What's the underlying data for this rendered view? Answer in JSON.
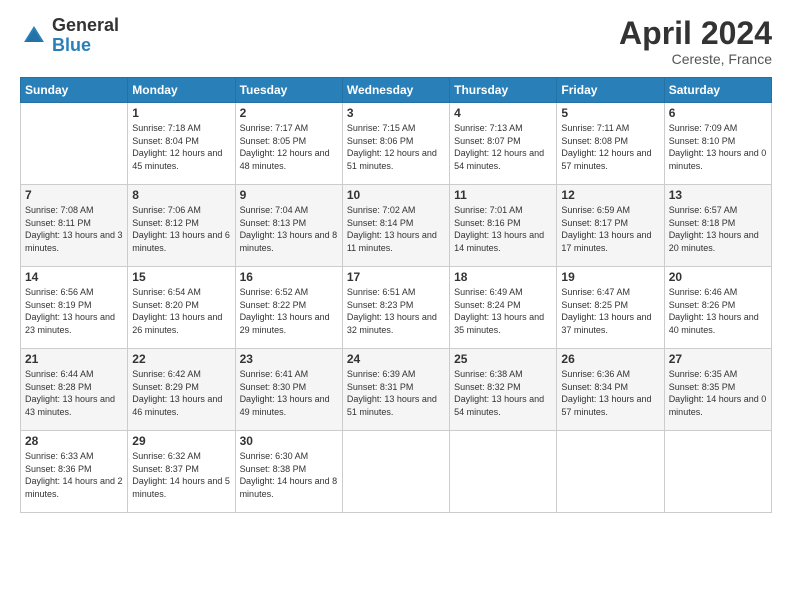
{
  "logo": {
    "general": "General",
    "blue": "Blue"
  },
  "title": "April 2024",
  "location": "Cereste, France",
  "days_header": [
    "Sunday",
    "Monday",
    "Tuesday",
    "Wednesday",
    "Thursday",
    "Friday",
    "Saturday"
  ],
  "weeks": [
    {
      "days": [
        {
          "num": "",
          "sunrise": "",
          "sunset": "",
          "daylight": ""
        },
        {
          "num": "1",
          "sunrise": "Sunrise: 7:18 AM",
          "sunset": "Sunset: 8:04 PM",
          "daylight": "Daylight: 12 hours and 45 minutes."
        },
        {
          "num": "2",
          "sunrise": "Sunrise: 7:17 AM",
          "sunset": "Sunset: 8:05 PM",
          "daylight": "Daylight: 12 hours and 48 minutes."
        },
        {
          "num": "3",
          "sunrise": "Sunrise: 7:15 AM",
          "sunset": "Sunset: 8:06 PM",
          "daylight": "Daylight: 12 hours and 51 minutes."
        },
        {
          "num": "4",
          "sunrise": "Sunrise: 7:13 AM",
          "sunset": "Sunset: 8:07 PM",
          "daylight": "Daylight: 12 hours and 54 minutes."
        },
        {
          "num": "5",
          "sunrise": "Sunrise: 7:11 AM",
          "sunset": "Sunset: 8:08 PM",
          "daylight": "Daylight: 12 hours and 57 minutes."
        },
        {
          "num": "6",
          "sunrise": "Sunrise: 7:09 AM",
          "sunset": "Sunset: 8:10 PM",
          "daylight": "Daylight: 13 hours and 0 minutes."
        }
      ]
    },
    {
      "days": [
        {
          "num": "7",
          "sunrise": "Sunrise: 7:08 AM",
          "sunset": "Sunset: 8:11 PM",
          "daylight": "Daylight: 13 hours and 3 minutes."
        },
        {
          "num": "8",
          "sunrise": "Sunrise: 7:06 AM",
          "sunset": "Sunset: 8:12 PM",
          "daylight": "Daylight: 13 hours and 6 minutes."
        },
        {
          "num": "9",
          "sunrise": "Sunrise: 7:04 AM",
          "sunset": "Sunset: 8:13 PM",
          "daylight": "Daylight: 13 hours and 8 minutes."
        },
        {
          "num": "10",
          "sunrise": "Sunrise: 7:02 AM",
          "sunset": "Sunset: 8:14 PM",
          "daylight": "Daylight: 13 hours and 11 minutes."
        },
        {
          "num": "11",
          "sunrise": "Sunrise: 7:01 AM",
          "sunset": "Sunset: 8:16 PM",
          "daylight": "Daylight: 13 hours and 14 minutes."
        },
        {
          "num": "12",
          "sunrise": "Sunrise: 6:59 AM",
          "sunset": "Sunset: 8:17 PM",
          "daylight": "Daylight: 13 hours and 17 minutes."
        },
        {
          "num": "13",
          "sunrise": "Sunrise: 6:57 AM",
          "sunset": "Sunset: 8:18 PM",
          "daylight": "Daylight: 13 hours and 20 minutes."
        }
      ]
    },
    {
      "days": [
        {
          "num": "14",
          "sunrise": "Sunrise: 6:56 AM",
          "sunset": "Sunset: 8:19 PM",
          "daylight": "Daylight: 13 hours and 23 minutes."
        },
        {
          "num": "15",
          "sunrise": "Sunrise: 6:54 AM",
          "sunset": "Sunset: 8:20 PM",
          "daylight": "Daylight: 13 hours and 26 minutes."
        },
        {
          "num": "16",
          "sunrise": "Sunrise: 6:52 AM",
          "sunset": "Sunset: 8:22 PM",
          "daylight": "Daylight: 13 hours and 29 minutes."
        },
        {
          "num": "17",
          "sunrise": "Sunrise: 6:51 AM",
          "sunset": "Sunset: 8:23 PM",
          "daylight": "Daylight: 13 hours and 32 minutes."
        },
        {
          "num": "18",
          "sunrise": "Sunrise: 6:49 AM",
          "sunset": "Sunset: 8:24 PM",
          "daylight": "Daylight: 13 hours and 35 minutes."
        },
        {
          "num": "19",
          "sunrise": "Sunrise: 6:47 AM",
          "sunset": "Sunset: 8:25 PM",
          "daylight": "Daylight: 13 hours and 37 minutes."
        },
        {
          "num": "20",
          "sunrise": "Sunrise: 6:46 AM",
          "sunset": "Sunset: 8:26 PM",
          "daylight": "Daylight: 13 hours and 40 minutes."
        }
      ]
    },
    {
      "days": [
        {
          "num": "21",
          "sunrise": "Sunrise: 6:44 AM",
          "sunset": "Sunset: 8:28 PM",
          "daylight": "Daylight: 13 hours and 43 minutes."
        },
        {
          "num": "22",
          "sunrise": "Sunrise: 6:42 AM",
          "sunset": "Sunset: 8:29 PM",
          "daylight": "Daylight: 13 hours and 46 minutes."
        },
        {
          "num": "23",
          "sunrise": "Sunrise: 6:41 AM",
          "sunset": "Sunset: 8:30 PM",
          "daylight": "Daylight: 13 hours and 49 minutes."
        },
        {
          "num": "24",
          "sunrise": "Sunrise: 6:39 AM",
          "sunset": "Sunset: 8:31 PM",
          "daylight": "Daylight: 13 hours and 51 minutes."
        },
        {
          "num": "25",
          "sunrise": "Sunrise: 6:38 AM",
          "sunset": "Sunset: 8:32 PM",
          "daylight": "Daylight: 13 hours and 54 minutes."
        },
        {
          "num": "26",
          "sunrise": "Sunrise: 6:36 AM",
          "sunset": "Sunset: 8:34 PM",
          "daylight": "Daylight: 13 hours and 57 minutes."
        },
        {
          "num": "27",
          "sunrise": "Sunrise: 6:35 AM",
          "sunset": "Sunset: 8:35 PM",
          "daylight": "Daylight: 14 hours and 0 minutes."
        }
      ]
    },
    {
      "days": [
        {
          "num": "28",
          "sunrise": "Sunrise: 6:33 AM",
          "sunset": "Sunset: 8:36 PM",
          "daylight": "Daylight: 14 hours and 2 minutes."
        },
        {
          "num": "29",
          "sunrise": "Sunrise: 6:32 AM",
          "sunset": "Sunset: 8:37 PM",
          "daylight": "Daylight: 14 hours and 5 minutes."
        },
        {
          "num": "30",
          "sunrise": "Sunrise: 6:30 AM",
          "sunset": "Sunset: 8:38 PM",
          "daylight": "Daylight: 14 hours and 8 minutes."
        },
        {
          "num": "",
          "sunrise": "",
          "sunset": "",
          "daylight": ""
        },
        {
          "num": "",
          "sunrise": "",
          "sunset": "",
          "daylight": ""
        },
        {
          "num": "",
          "sunrise": "",
          "sunset": "",
          "daylight": ""
        },
        {
          "num": "",
          "sunrise": "",
          "sunset": "",
          "daylight": ""
        }
      ]
    }
  ]
}
